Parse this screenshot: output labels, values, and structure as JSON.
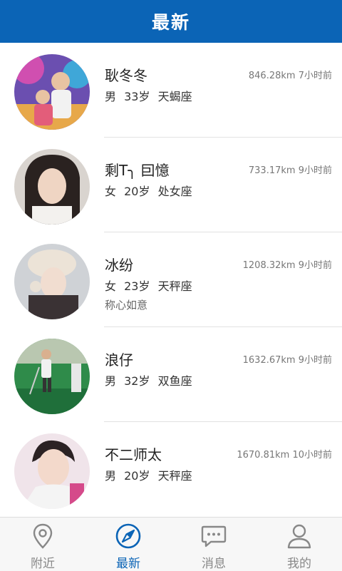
{
  "header": {
    "title": "最新"
  },
  "colors": {
    "accent": "#0b64b6",
    "inactive": "#888888"
  },
  "users": [
    {
      "name": "耿冬冬",
      "distance": "846.28km",
      "time": "7小时前",
      "gender": "男",
      "age": "33岁",
      "sign_zodiac": "天蝎座",
      "status": ""
    },
    {
      "name": "剩T╮ 囙憶",
      "distance": "733.17km",
      "time": "9小时前",
      "gender": "女",
      "age": "20岁",
      "sign_zodiac": "处女座",
      "status": ""
    },
    {
      "name": "冰纷",
      "distance": "1208.32km",
      "time": "9小时前",
      "gender": "女",
      "age": "23岁",
      "sign_zodiac": "天秤座",
      "status": "称心如意"
    },
    {
      "name": "浪仔",
      "distance": "1632.67km",
      "time": "9小时前",
      "gender": "男",
      "age": "32岁",
      "sign_zodiac": "双鱼座",
      "status": ""
    },
    {
      "name": "不二师太",
      "distance": "1670.81km",
      "time": "10小时前",
      "gender": "男",
      "age": "20岁",
      "sign_zodiac": "天秤座",
      "status": ""
    }
  ],
  "tabs": [
    {
      "label": "附近",
      "icon": "location-pin-icon",
      "active": false
    },
    {
      "label": "最新",
      "icon": "compass-icon",
      "active": true
    },
    {
      "label": "消息",
      "icon": "chat-bubble-icon",
      "active": false
    },
    {
      "label": "我的",
      "icon": "user-icon",
      "active": false
    }
  ]
}
